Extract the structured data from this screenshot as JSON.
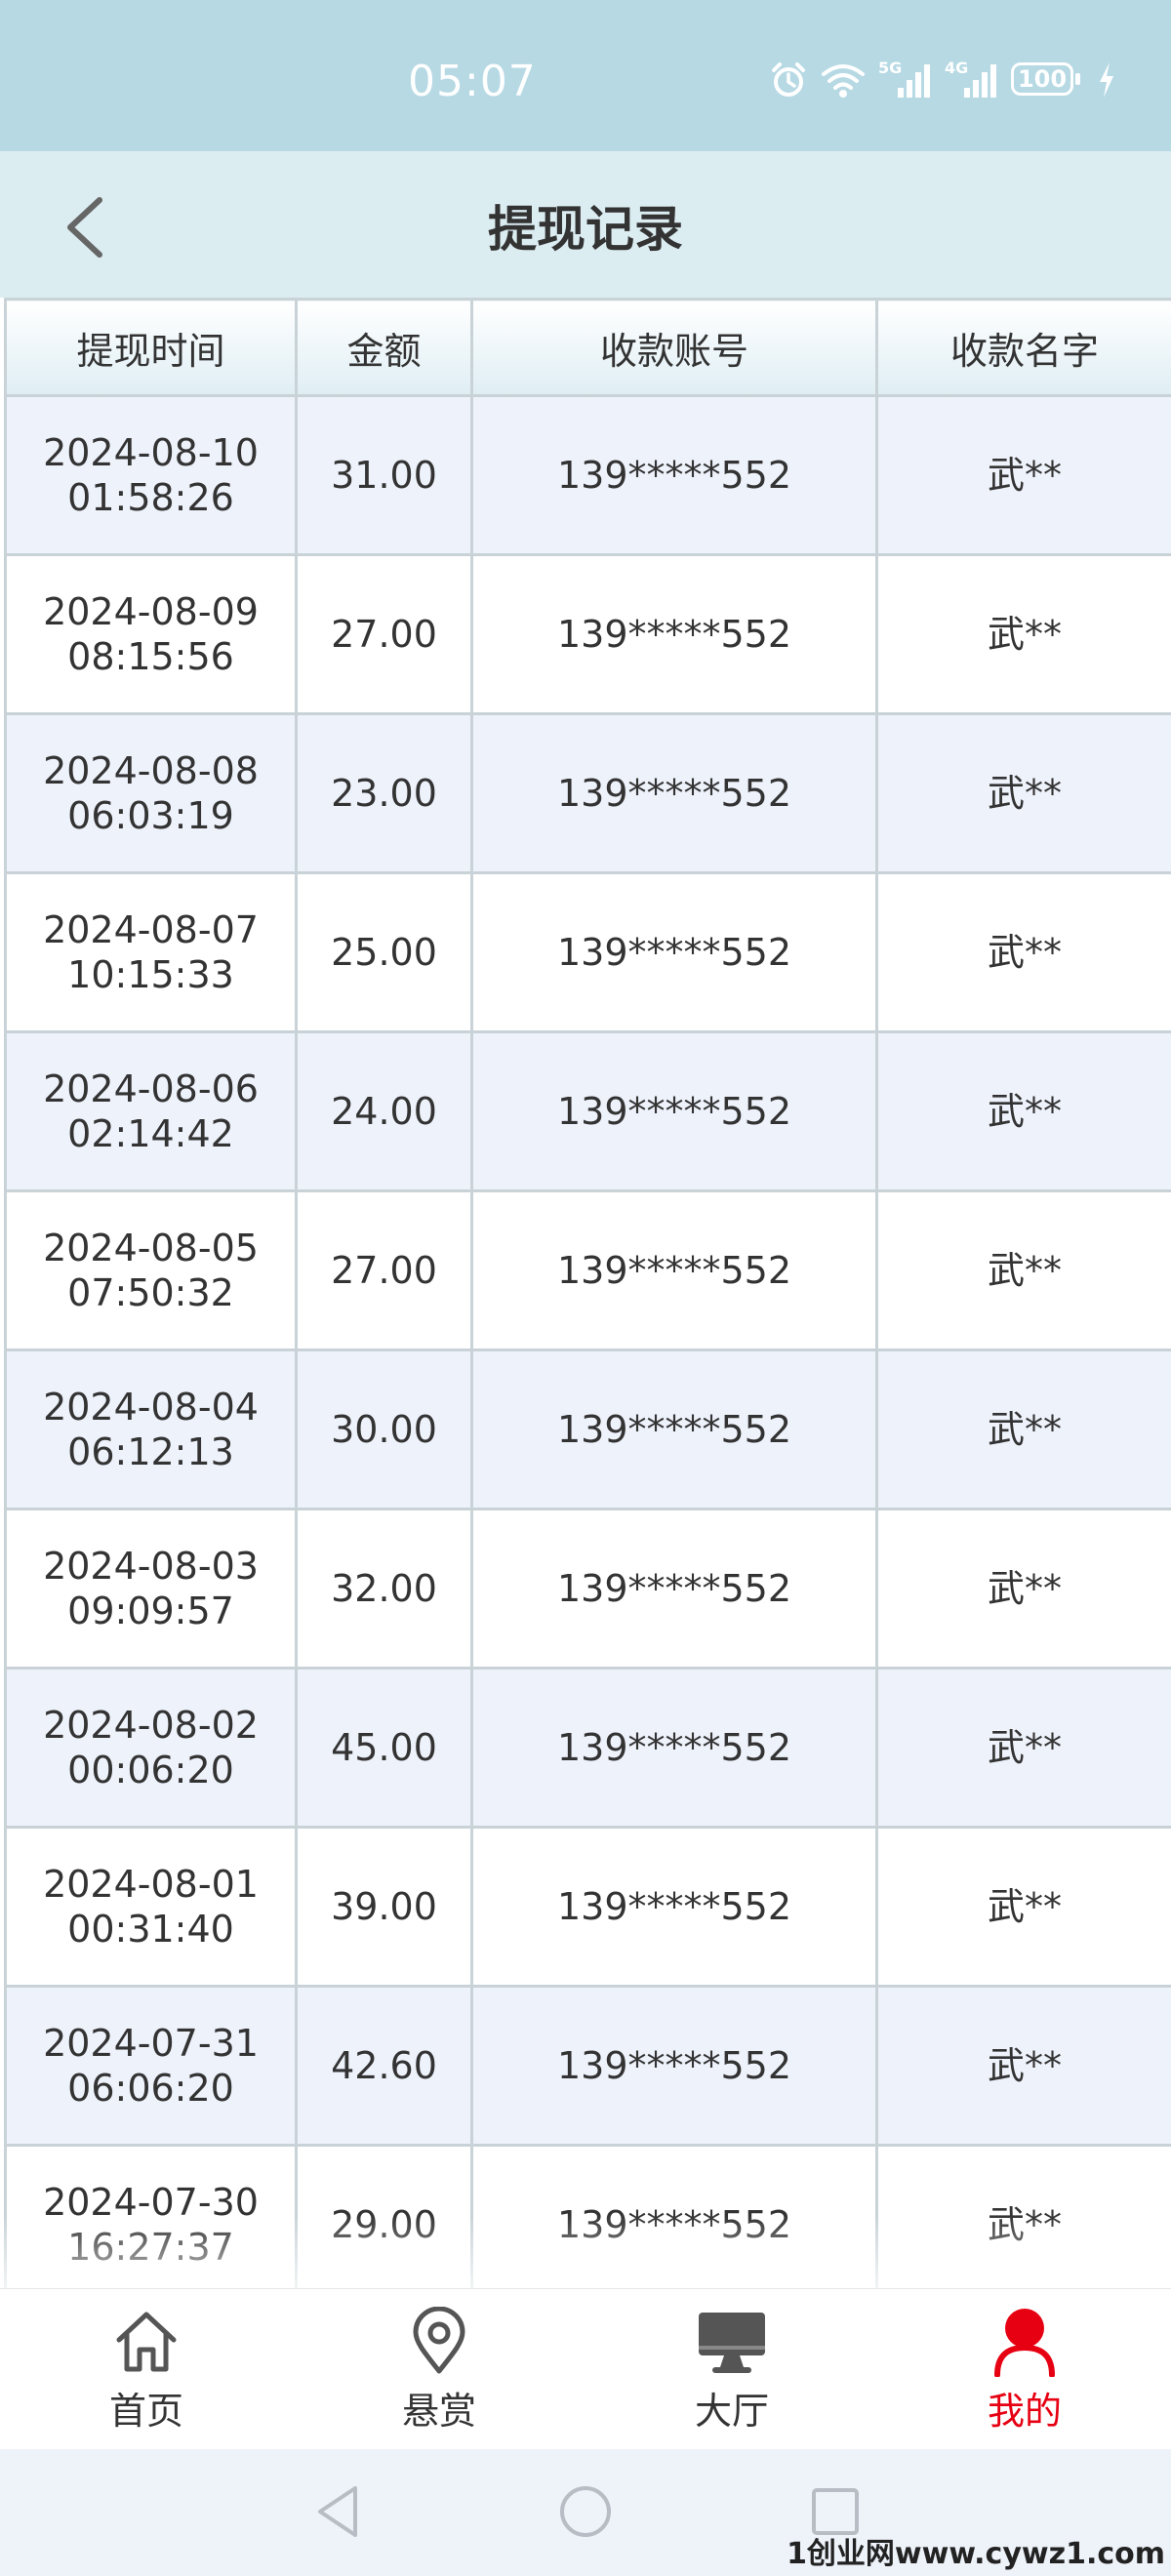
{
  "status_bar": {
    "time": "05:07",
    "signal_5g": "5G",
    "signal_4g": "4G",
    "battery": "100"
  },
  "header": {
    "title": "提现记录"
  },
  "table": {
    "headers": [
      "提现时间",
      "金额",
      "收款账号",
      "收款名字"
    ],
    "rows": [
      {
        "date": "2024-08-10",
        "time": "01:58:26",
        "amount": "31.00",
        "account": "139*****552",
        "name": "武**"
      },
      {
        "date": "2024-08-09",
        "time": "08:15:56",
        "amount": "27.00",
        "account": "139*****552",
        "name": "武**"
      },
      {
        "date": "2024-08-08",
        "time": "06:03:19",
        "amount": "23.00",
        "account": "139*****552",
        "name": "武**"
      },
      {
        "date": "2024-08-07",
        "time": "10:15:33",
        "amount": "25.00",
        "account": "139*****552",
        "name": "武**"
      },
      {
        "date": "2024-08-06",
        "time": "02:14:42",
        "amount": "24.00",
        "account": "139*****552",
        "name": "武**"
      },
      {
        "date": "2024-08-05",
        "time": "07:50:32",
        "amount": "27.00",
        "account": "139*****552",
        "name": "武**"
      },
      {
        "date": "2024-08-04",
        "time": "06:12:13",
        "amount": "30.00",
        "account": "139*****552",
        "name": "武**"
      },
      {
        "date": "2024-08-03",
        "time": "09:09:57",
        "amount": "32.00",
        "account": "139*****552",
        "name": "武**"
      },
      {
        "date": "2024-08-02",
        "time": "00:06:20",
        "amount": "45.00",
        "account": "139*****552",
        "name": "武**"
      },
      {
        "date": "2024-08-01",
        "time": "00:31:40",
        "amount": "39.00",
        "account": "139*****552",
        "name": "武**"
      },
      {
        "date": "2024-07-31",
        "time": "06:06:20",
        "amount": "42.60",
        "account": "139*****552",
        "name": "武**"
      },
      {
        "date": "2024-07-30",
        "time": "16:27:37",
        "amount": "29.00",
        "account": "139*****552",
        "name": "武**"
      }
    ]
  },
  "bottom_nav": {
    "items": [
      {
        "label": "首页",
        "icon": "home-icon"
      },
      {
        "label": "悬赏",
        "icon": "location-pin-icon"
      },
      {
        "label": "大厅",
        "icon": "monitor-icon"
      },
      {
        "label": "我的",
        "icon": "user-icon",
        "active": true
      }
    ],
    "active_color": "#e60012"
  },
  "watermark": "1创业网www.cywz1.com"
}
